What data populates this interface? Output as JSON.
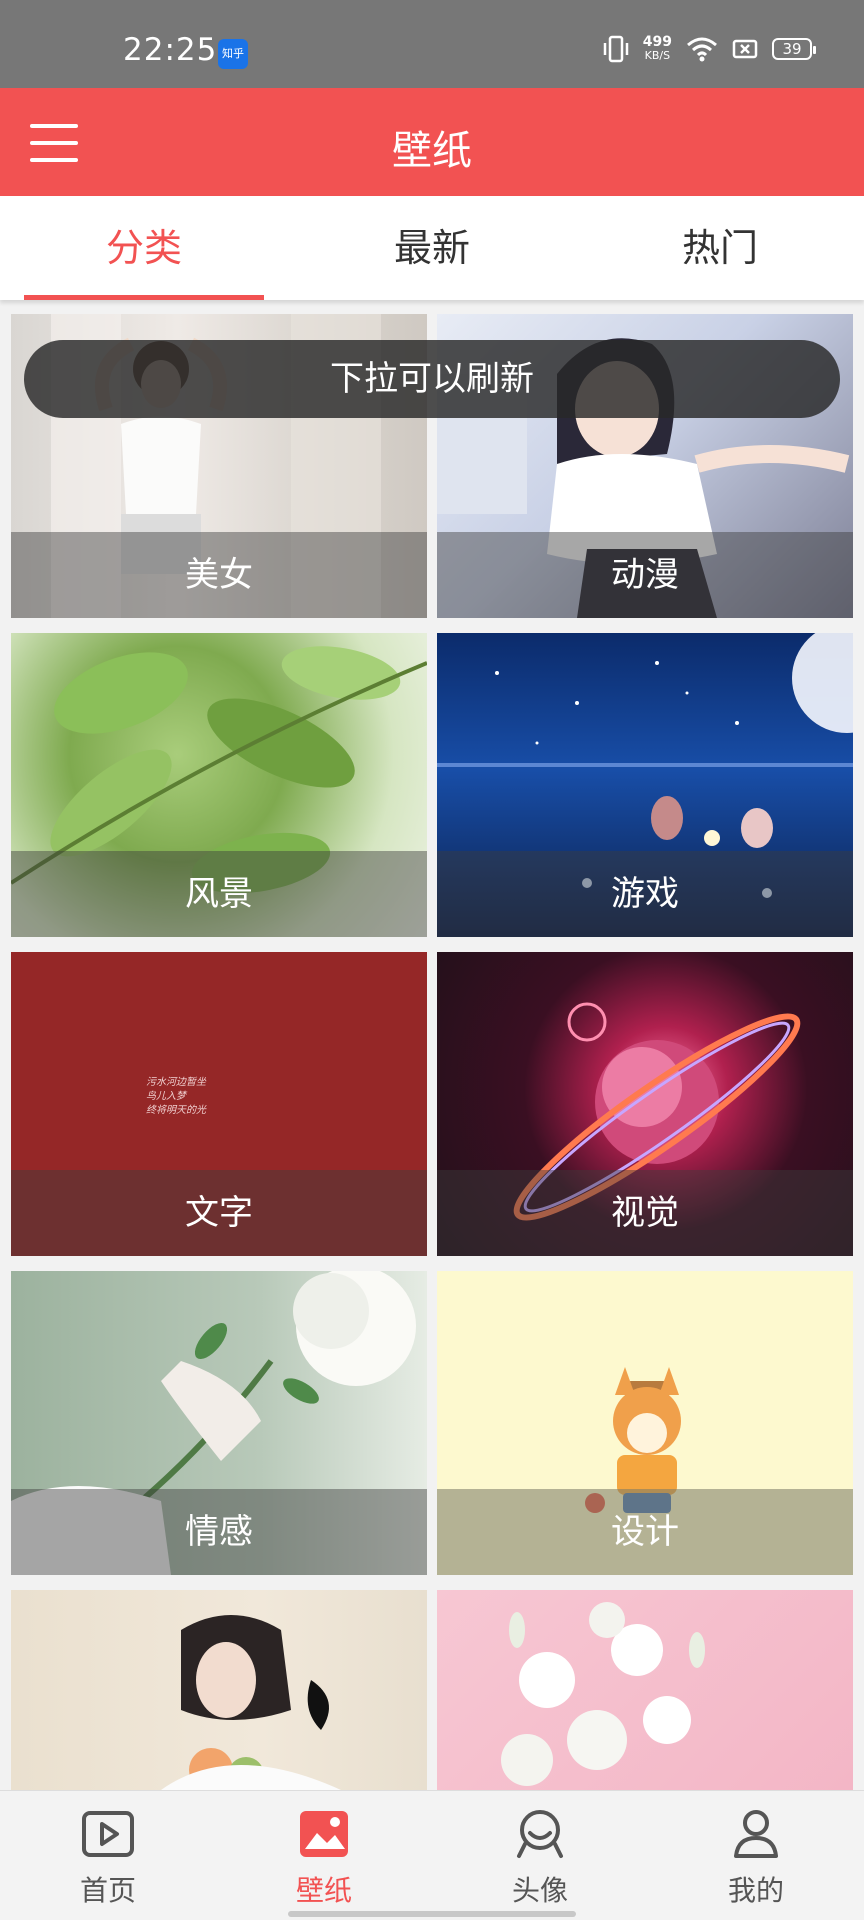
{
  "status_bar": {
    "time": "22:25",
    "app_badge": "知乎",
    "net_speed_value": "499",
    "net_speed_unit": "KB/S",
    "battery": "39"
  },
  "app_bar": {
    "title": "壁纸"
  },
  "tabs": [
    {
      "label": "分类",
      "active": true
    },
    {
      "label": "最新",
      "active": false
    },
    {
      "label": "热门",
      "active": false
    }
  ],
  "toast": "下拉可以刷新",
  "categories": [
    {
      "label": "美女"
    },
    {
      "label": "动漫"
    },
    {
      "label": "风景"
    },
    {
      "label": "游戏"
    },
    {
      "label": "文字",
      "overlay_text": "污水河边暂坐\n鸟儿入梦\n终将明天的光"
    },
    {
      "label": "视觉"
    },
    {
      "label": "情感"
    },
    {
      "label": "设计"
    },
    {
      "label": ""
    },
    {
      "label": ""
    }
  ],
  "bottom_nav": [
    {
      "label": "首页",
      "icon": "play-icon",
      "active": false
    },
    {
      "label": "壁纸",
      "icon": "image-icon",
      "active": true
    },
    {
      "label": "头像",
      "icon": "avatar-icon",
      "active": false
    },
    {
      "label": "我的",
      "icon": "user-icon",
      "active": false
    }
  ],
  "colors": {
    "accent": "#f25252",
    "status_bar": "#777777"
  }
}
